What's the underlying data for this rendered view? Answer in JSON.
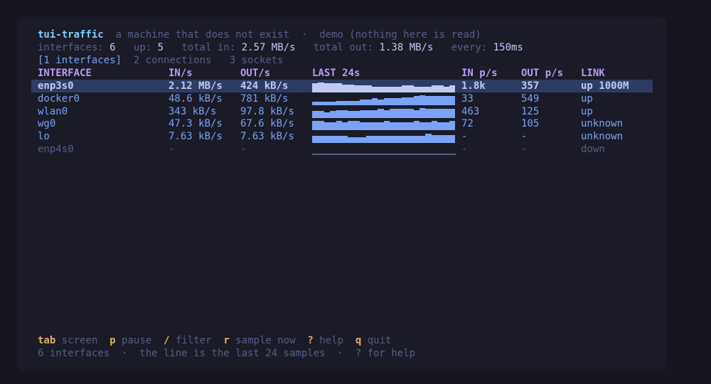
{
  "header": {
    "app_name": "tui-traffic",
    "subtitle": "a machine that does not exist  ·  demo (nothing here is read)"
  },
  "stats": {
    "interfaces_label": "interfaces:",
    "interfaces_value": "6",
    "up_label": "up:",
    "up_value": "5",
    "total_in_label": "total in:",
    "total_in_value": "2.57 MB/s",
    "total_out_label": "total out:",
    "total_out_value": "1.38 MB/s",
    "every_label": "every:",
    "every_value": "150ms"
  },
  "tabs": [
    {
      "label": "[1 interfaces]",
      "active": true
    },
    {
      "label": "2 connections",
      "active": false
    },
    {
      "label": "3 sockets",
      "active": false
    }
  ],
  "table": {
    "columns": [
      "INTERFACE",
      "IN/s",
      "OUT/s",
      "LAST 24s",
      "IN p/s",
      "OUT p/s",
      "LINK"
    ],
    "rows": [
      {
        "name": "enp3s0",
        "in": "2.12 MB/s",
        "out": "424 kB/s",
        "in_pps": "1.8k",
        "out_pps": "357",
        "link": "up 1000M",
        "state": "selected",
        "spark": [
          0.8,
          0.9,
          0.8,
          0.8,
          0.8,
          0.7,
          0.7,
          0.6,
          0.6,
          0.6,
          0.5,
          0.5,
          0.5,
          0.5,
          0.5,
          0.6,
          0.6,
          0.5,
          0.5,
          0.5,
          0.6,
          0.6,
          0.5,
          0.6
        ]
      },
      {
        "name": "docker0",
        "in": "48.6 kB/s",
        "out": "781 kB/s",
        "in_pps": "33",
        "out_pps": "549",
        "link": "up",
        "state": "normal",
        "spark": [
          0.3,
          0.3,
          0.3,
          0.3,
          0.4,
          0.4,
          0.4,
          0.4,
          0.5,
          0.5,
          0.6,
          0.5,
          0.6,
          0.6,
          0.6,
          0.7,
          0.7,
          0.8,
          0.9,
          0.8,
          0.8,
          0.8,
          0.8,
          0.8
        ]
      },
      {
        "name": "wlan0",
        "in": "343 kB/s",
        "out": "97.8 kB/s",
        "in_pps": "463",
        "out_pps": "125",
        "link": "up",
        "state": "normal",
        "spark": [
          0.6,
          0.6,
          0.5,
          0.6,
          0.7,
          0.7,
          0.6,
          0.6,
          0.7,
          0.7,
          0.7,
          0.8,
          0.7,
          0.8,
          0.8,
          0.8,
          0.8,
          0.7,
          0.9,
          0.8,
          0.8,
          0.8,
          0.8,
          0.8
        ]
      },
      {
        "name": "wg0",
        "in": "47.3 kB/s",
        "out": "67.6 kB/s",
        "in_pps": "72",
        "out_pps": "105",
        "link": "unknown",
        "state": "normal",
        "spark": [
          0.8,
          0.8,
          0.7,
          0.7,
          0.8,
          0.7,
          0.8,
          0.8,
          0.7,
          0.7,
          0.7,
          0.7,
          0.8,
          0.7,
          0.7,
          0.7,
          0.7,
          0.8,
          0.7,
          0.7,
          0.8,
          0.7,
          0.7,
          0.8
        ]
      },
      {
        "name": "lo",
        "in": "7.63 kB/s",
        "out": "7.63 kB/s",
        "in_pps": "-",
        "out_pps": "-",
        "link": "unknown",
        "state": "normal",
        "spark": [
          0.6,
          0.6,
          0.6,
          0.6,
          0.6,
          0.6,
          0.5,
          0.5,
          0.5,
          0.6,
          0.6,
          0.6,
          0.6,
          0.6,
          0.6,
          0.6,
          0.6,
          0.6,
          0.6,
          0.8,
          0.7,
          0.7,
          0.7,
          0.7
        ]
      },
      {
        "name": "enp4s0",
        "in": "-",
        "out": "-",
        "in_pps": "-",
        "out_pps": "-",
        "link": "down",
        "state": "down",
        "spark": []
      }
    ]
  },
  "footer": {
    "keys": [
      {
        "key": "tab",
        "label": "screen"
      },
      {
        "key": "p",
        "label": "pause"
      },
      {
        "key": "/",
        "label": "filter"
      },
      {
        "key": "r",
        "label": "sample now"
      },
      {
        "key": "?",
        "label": "help"
      },
      {
        "key": "q",
        "label": "quit"
      }
    ],
    "status": "6 interfaces  ·  the line is the last 24 samples  ·  ? for help"
  },
  "colors": {
    "background": "#1a1b26",
    "accent": "#7aa2f7",
    "header": "#bb9af7",
    "key": "#e0af68",
    "selected_row": "#2e3c64"
  }
}
